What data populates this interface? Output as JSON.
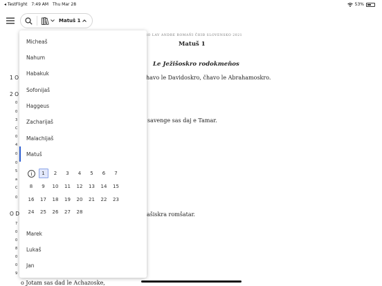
{
  "status": {
    "back_app": "◂ TestFlight",
    "time": "7:49 AM",
    "date": "Thu Mar 28",
    "battery": "53%",
    "battery_fraction": 0.53
  },
  "toolbar": {
    "book_button": "Matuš 1"
  },
  "reader": {
    "copyright": "ZERO LAV ANDRE ROMAŇI ČHIB SLOVENSKO 2021",
    "chapter_title": "Matuš 1",
    "section_heading": "Le Ježišoskro rodokmeňos",
    "lines": [
      {
        "text": "havo le Davidoskro, čhavo le Abrahamoskro."
      },
      {
        "text": "savenge sas daj e Tamar."
      },
      {
        "text": "ašiskra romšatar."
      },
      {
        "text": "o Jotam sas dad le Achazoske,"
      }
    ],
    "margin_chars": [
      "1 O",
      "2 O",
      "0",
      "0",
      "3",
      "C",
      "0",
      "4",
      "0",
      "0",
      "5",
      "a",
      "C",
      "0",
      "O D",
      "7",
      "0",
      "0",
      "8",
      "0",
      "0",
      "9"
    ]
  },
  "books": [
    "Micheaš",
    "Nahum",
    "Habakuk",
    "Sofonijaš",
    "Haggeus",
    "Zacharijaš",
    "Malachijaš",
    "Matuš",
    "Marek",
    "Lukaš",
    "Jan"
  ],
  "chapters": [
    "1",
    "2",
    "3",
    "4",
    "5",
    "6",
    "7",
    "8",
    "9",
    "10",
    "11",
    "12",
    "13",
    "14",
    "15",
    "16",
    "17",
    "18",
    "19",
    "20",
    "21",
    "22",
    "23",
    "24",
    "25",
    "26",
    "27",
    "28"
  ],
  "selected_chapter": "1",
  "accent": "#2f5fd1"
}
